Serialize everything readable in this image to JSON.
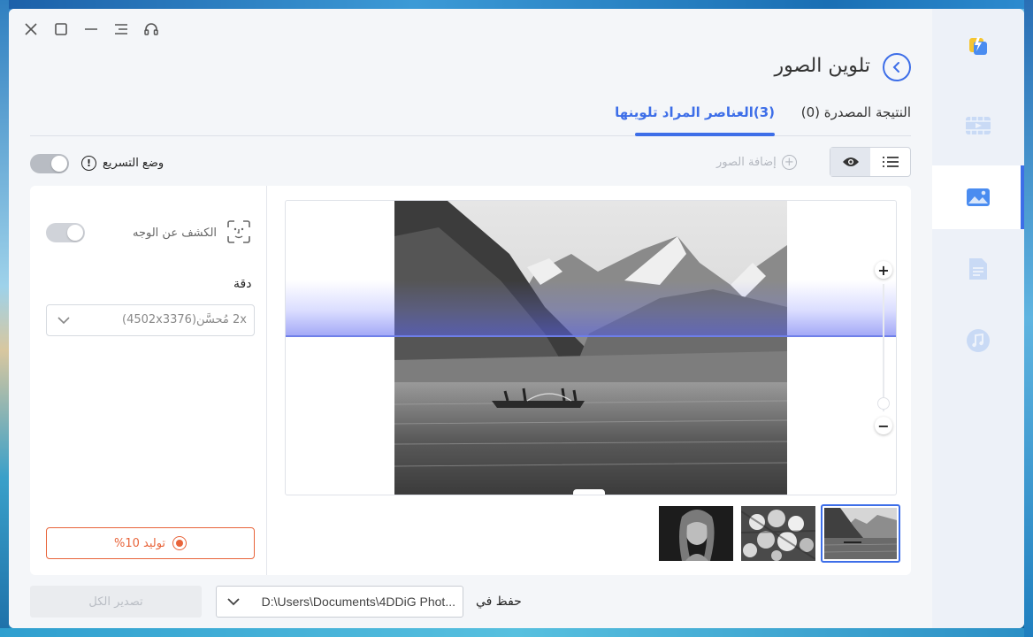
{
  "header": {
    "title": "تلوين الصور"
  },
  "tabs": {
    "result": "النتيجة المصدرة (0)",
    "items": "(3)العناصر المراد تلوينها"
  },
  "toolbar": {
    "speed_mode": "وضع التسريع",
    "info_glyph": "!",
    "add_photos": "إضافة الصور"
  },
  "left_panel": {
    "face_detection": "الكشف عن الوجه",
    "resolution_label": "دقة",
    "resolution_value": "2x مُحسَّن(4502x3376)",
    "generate_button": "توليد 10%"
  },
  "zoom": {
    "plus": "+",
    "minus": "−"
  },
  "footer": {
    "export_all": "تصدير الكل",
    "save_path": "D:\\Users\\Documents\\4DDiG Phot...",
    "save_in": "حفظ في"
  },
  "thumbnails": [
    "portrait",
    "flowers",
    "mountain-lake"
  ],
  "colors": {
    "accent": "#3d6ee8",
    "warning": "#e8643a"
  },
  "icons": {
    "window": [
      "close-icon",
      "maximize-icon",
      "minimize-icon",
      "menu-icon",
      "headset-icon"
    ],
    "sidebar": [
      "ai-enhance-icon",
      "video-icon",
      "image-icon",
      "document-icon",
      "music-icon"
    ]
  }
}
